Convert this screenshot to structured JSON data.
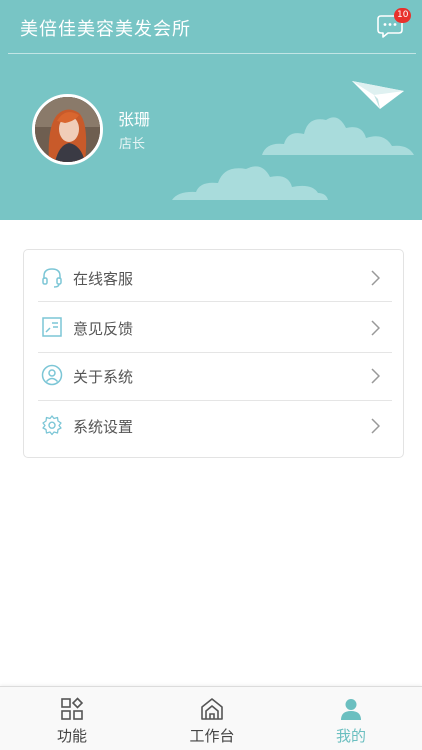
{
  "header": {
    "title": "美倍佳美容美发会所",
    "notification_count": "10",
    "user": {
      "name": "张珊",
      "role": "店长"
    }
  },
  "menu": {
    "items": [
      {
        "label": "在线客服",
        "icon": "headset-icon"
      },
      {
        "label": "意见反馈",
        "icon": "feedback-icon"
      },
      {
        "label": "关于系统",
        "icon": "user-circle-icon"
      },
      {
        "label": "系统设置",
        "icon": "settings-icon"
      }
    ]
  },
  "tabbar": {
    "tabs": [
      {
        "label": "功能",
        "icon": "grid-icon",
        "active": false
      },
      {
        "label": "工作台",
        "icon": "home-icon",
        "active": false
      },
      {
        "label": "我的",
        "icon": "person-icon",
        "active": true
      }
    ]
  },
  "colors": {
    "brand": "#78c5c5",
    "active_tab": "#6bbfc0",
    "badge": "#e8312c"
  }
}
